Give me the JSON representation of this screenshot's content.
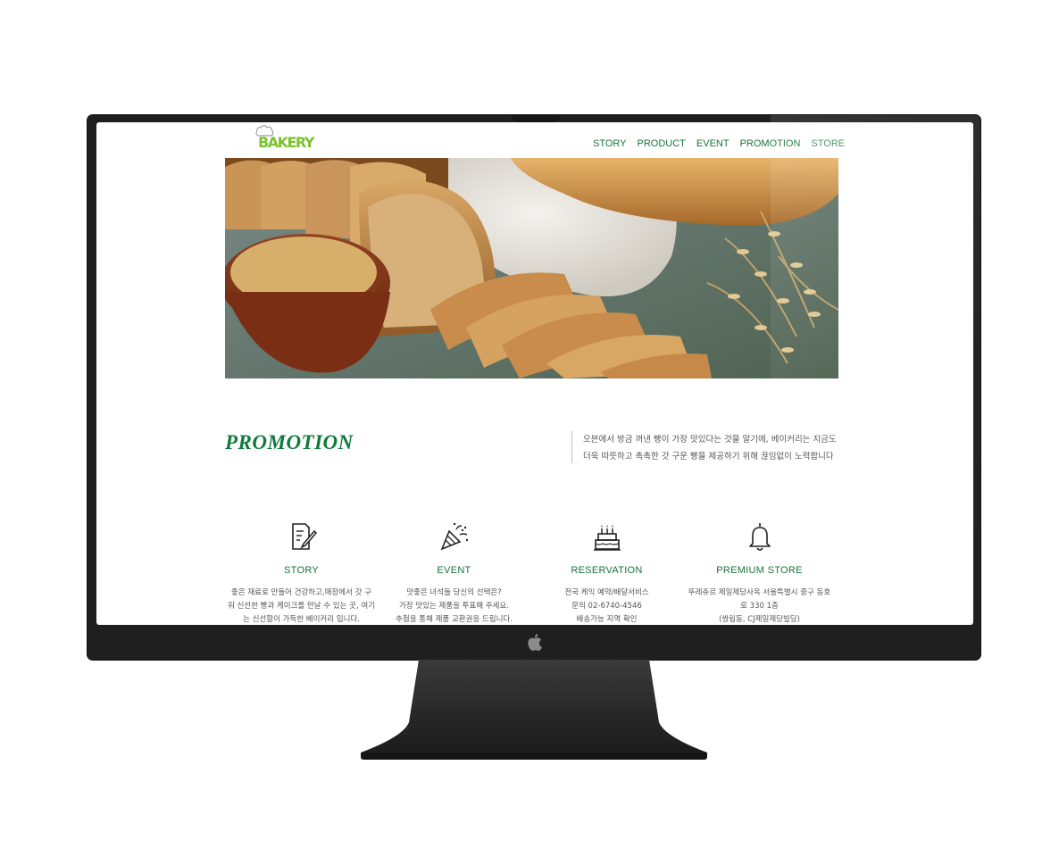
{
  "brand": {
    "logo_text": "BAKERY"
  },
  "nav": {
    "items": [
      {
        "label": "STORY"
      },
      {
        "label": "PRODUCT"
      },
      {
        "label": "EVENT"
      },
      {
        "label": "PROMOTION"
      },
      {
        "label": "STORE"
      }
    ]
  },
  "promotion": {
    "title": "PROMOTION",
    "description_line1": "오븐에서 방금 꺼낸 빵이 가장 맛있다는 것을 알기에, 베이커리는 지금도",
    "description_line2": "더욱 따뜻하고 촉촉한 갓 구운 빵을 제공하기 위해 끊임없이 노력합니다"
  },
  "features": [
    {
      "icon": "document-pen-icon",
      "title": "STORY",
      "lines": [
        "좋은 재료로 만들어 건강하고,매장에서 갓 구",
        "워 신선한 빵과 케이크를 만날 수 있는 곳, 여기",
        "는 신선함이 가득한 베이커리 입니다."
      ]
    },
    {
      "icon": "party-popper-icon",
      "title": "EVENT",
      "lines": [
        "맛좋은 녀석들 당신의 선택은?",
        "가장 맛있는 제품을 투표해 주세요.",
        "추첨을 통해 제품 교환권을 드립니다."
      ]
    },
    {
      "icon": "birthday-cake-icon",
      "title": "RESERVATION",
      "lines": [
        "전국 케익 예약/배달서비스",
        "문의 02-6740-4546",
        "배송가능 지역 확인"
      ]
    },
    {
      "icon": "bell-icon",
      "title": "PREMIUM STORE",
      "lines": [
        "뚜레쥬르 제일제당사옥 서울특별시 중구 동호",
        "로 330 1층",
        "(쌍림동, CJ제일제당빌딩)"
      ]
    }
  ],
  "colors": {
    "accent_green": "#16733a",
    "title_green": "#0f7a3a",
    "monitor_frame": "#1f1f1f"
  }
}
